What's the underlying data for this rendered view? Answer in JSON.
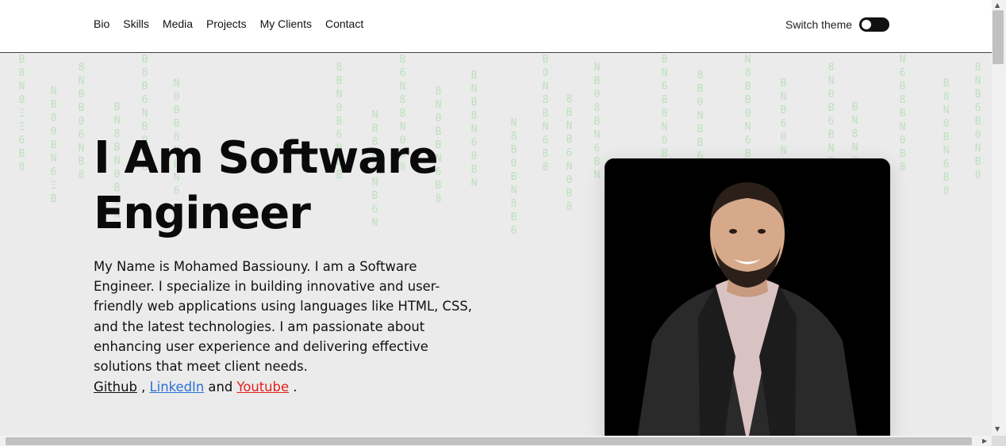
{
  "nav": {
    "items": [
      "Bio",
      "Skills",
      "Media",
      "Projects",
      "My Clients",
      "Contact"
    ],
    "theme_label": "Switch theme"
  },
  "hero": {
    "headline": "I Am Software Engineer",
    "bio": "My Name is Mohamed Bassiouny. I am a Software Engineer. I specialize in building innovative and user-friendly web applications using languages like HTML, CSS, and the latest technologies. I am passionate about enhancing user experience and delivering effective solutions that meet client needs.",
    "links": {
      "github": "Github",
      "sep1": " , ",
      "linkedin": "LinkedIn",
      "sep2": " and ",
      "youtube": "Youtube",
      "end": " ."
    }
  },
  "colors": {
    "linkedin": "#2a6fd6",
    "youtube": "#e0201b",
    "hero_bg": "#ebebeb",
    "matrix": "#66cc66"
  }
}
